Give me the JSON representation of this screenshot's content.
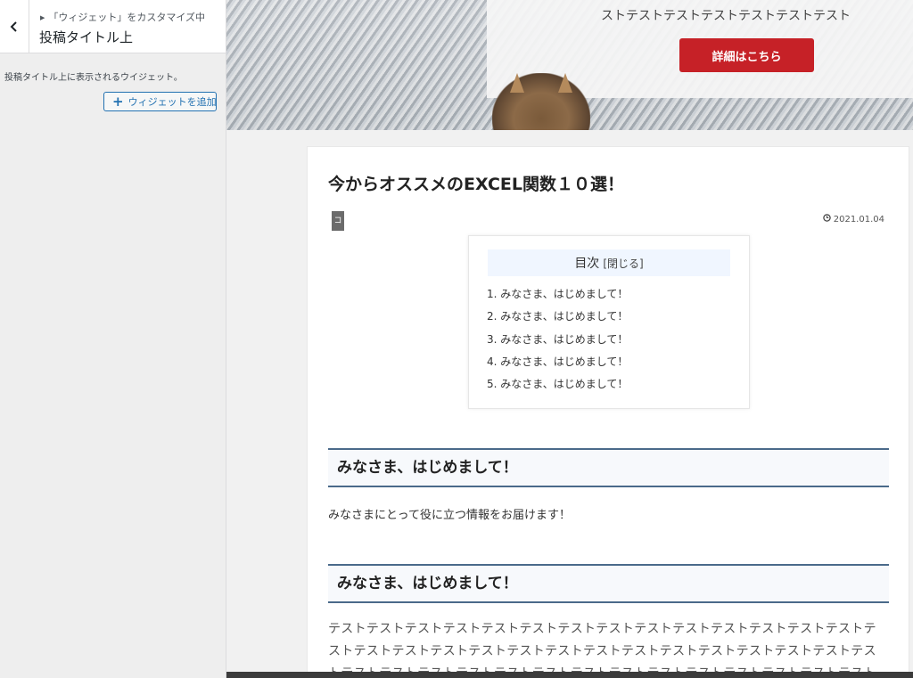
{
  "sidebar": {
    "breadcrumb": "「ウィジェット」をカスタマイズ中",
    "title": "投稿タイトル上",
    "description": "投稿タイトル上に表示されるウイジェット。",
    "add_widget_label": "ウィジェットを追加",
    "back_icon": "chevron-left-icon",
    "add_icon": "plus-icon"
  },
  "preview": {
    "hero": {
      "text": "ストテストテストテストテストテストテスト",
      "button_label": "詳細はこちら",
      "button_color": "#c62127"
    },
    "article": {
      "title": "今からオススメのEXCEL関数１０選！",
      "category_tag": "コ",
      "date": "2021.01.04",
      "toc": {
        "heading": "目次",
        "toggle_label": "[閉じる]",
        "items": [
          "1. みなさま、はじめまして！",
          "2. みなさま、はじめまして！",
          "3. みなさま、はじめまして！",
          "4. みなさま、はじめまして！",
          "5. みなさま、はじめまして！"
        ]
      },
      "sections": [
        {
          "heading": "みなさま、はじめまして！",
          "body": "みなさまにとって役に立つ情報をお届けます！"
        },
        {
          "heading": "みなさま、はじめまして！",
          "body": "テストテストテストテストテストテストテストテストテストテストテストテストテストテストテストテストテストテストテストテストテストテストテストテストテストテストテストテストテストテストテストテストテストテストテストテストテストテストテストテストテストテストテストテスト"
        }
      ]
    }
  }
}
